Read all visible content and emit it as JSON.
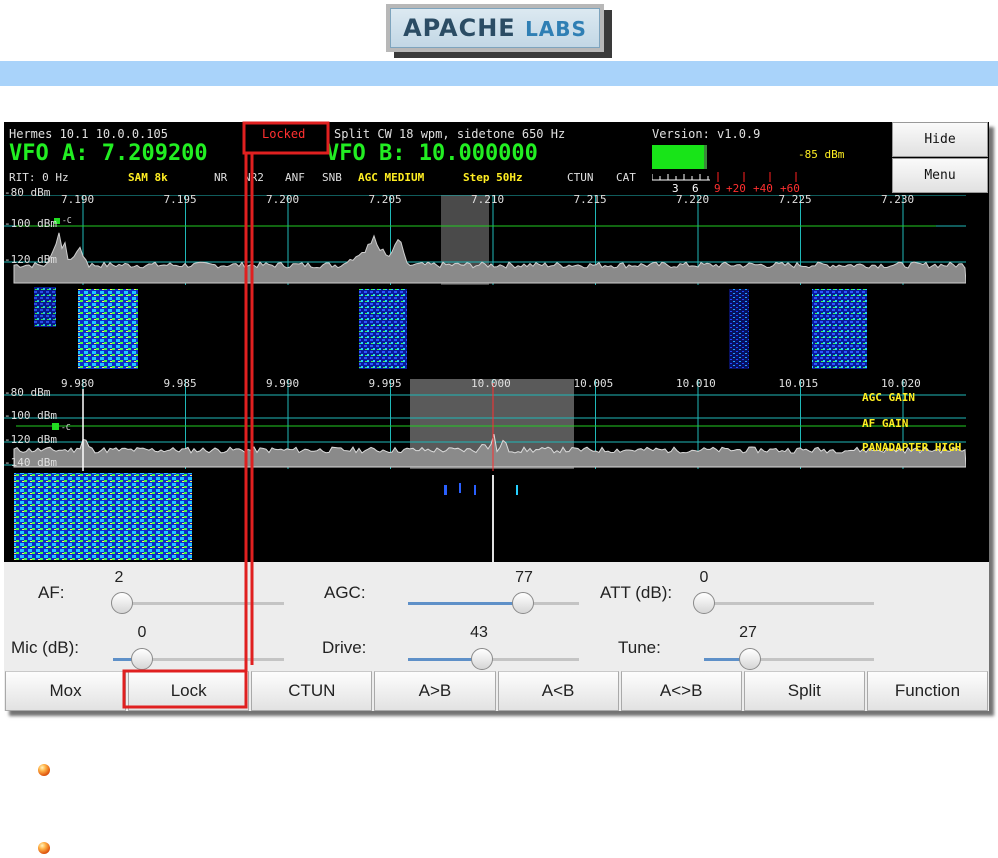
{
  "header": {
    "logo_left": "APACHE",
    "logo_right": "LABS"
  },
  "status": {
    "radio": "Hermes 10.1 10.0.0.105",
    "locked": "Locked",
    "split_info": "Split CW 18 wpm, sidetone 650 Hz",
    "version": "Version: v1.0.9",
    "vfo_a": "VFO A: 7.209200",
    "vfo_b": "VFO B: 10.000000",
    "rit": "RIT: 0 Hz",
    "mode": "SAM 8k",
    "nr": "NR",
    "nr2": "NR2",
    "anf": "ANF",
    "snb": "SNB",
    "agc": "AGC MEDIUM",
    "step": "Step 50Hz",
    "ctun": "CTUN",
    "cat": "CAT",
    "dbm": "-85 dBm",
    "meter_white": [
      "3",
      "6"
    ],
    "meter_red": [
      "9",
      "+20",
      "+40",
      "+60"
    ]
  },
  "side_buttons": {
    "hide": "Hide",
    "menu": "Menu"
  },
  "panadapter_a": {
    "freqs": [
      "7.190",
      "7.195",
      "7.200",
      "7.205",
      "7.210",
      "7.215",
      "7.220",
      "7.225",
      "7.230"
    ],
    "db": [
      "-80 dBm",
      "-100 dBm",
      "-120 dBm"
    ]
  },
  "panadapter_b": {
    "freqs": [
      "9.980",
      "9.985",
      "9.990",
      "9.995",
      "10.000",
      "10.005",
      "10.010",
      "10.015",
      "10.020"
    ],
    "db": [
      "-80 dBm",
      "-100 dBm",
      "-120 dBm",
      "-140 dBm"
    ],
    "overlay": [
      "AGC GAIN",
      "AF GAIN",
      "PANADAPTER HIGH"
    ]
  },
  "controls": {
    "af": {
      "label": "AF:",
      "value": "2",
      "fraction": 0.02
    },
    "agc": {
      "label": "AGC:",
      "value": "77",
      "fraction": 0.67
    },
    "att": {
      "label": "ATT (dB):",
      "value": "0",
      "fraction": 0.0
    },
    "mic": {
      "label": "Mic (dB):",
      "value": "0",
      "fraction": 0.17
    },
    "drive": {
      "label": "Drive:",
      "value": "43",
      "fraction": 0.43
    },
    "tune": {
      "label": "Tune:",
      "value": "27",
      "fraction": 0.27
    }
  },
  "buttons": [
    "Mox",
    "Lock",
    "CTUN",
    "A>B",
    "A<B",
    "A<>B",
    "Split",
    "Function"
  ],
  "colors": {
    "vfo": "#22ee22",
    "yellow": "#ffee22",
    "grid": "#1fb8b8",
    "red_annotation": "#e02020",
    "accent": "#a9d3fa"
  }
}
